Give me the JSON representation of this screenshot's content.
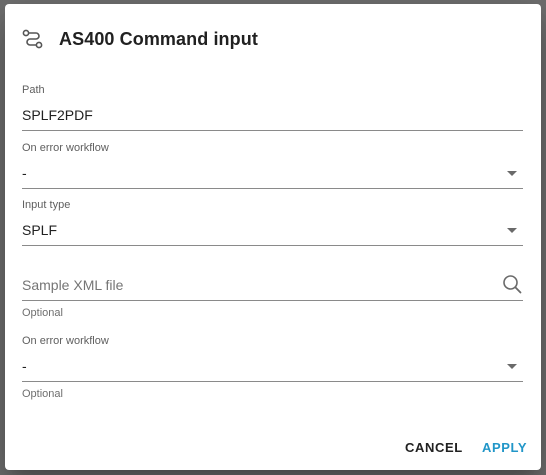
{
  "dialog": {
    "title": "AS400 Command input",
    "title_icon": "route-icon"
  },
  "fields": {
    "path": {
      "label": "Path",
      "value": "SPLF2PDF"
    },
    "on_error_workflow_1": {
      "label": "On error workflow",
      "value": "-"
    },
    "input_type": {
      "label": "Input type",
      "value": "SPLF"
    },
    "sample_xml": {
      "placeholder": "Sample XML file",
      "hint": "Optional",
      "icon": "search-icon"
    },
    "on_error_workflow_2": {
      "label": "On error workflow",
      "value": "-",
      "hint": "Optional"
    }
  },
  "actions": {
    "cancel_label": "CANCEL",
    "apply_label": "APPLY"
  },
  "colors": {
    "accent": "#2196c8",
    "text": "#212121",
    "underline": "#8a8a8a"
  }
}
